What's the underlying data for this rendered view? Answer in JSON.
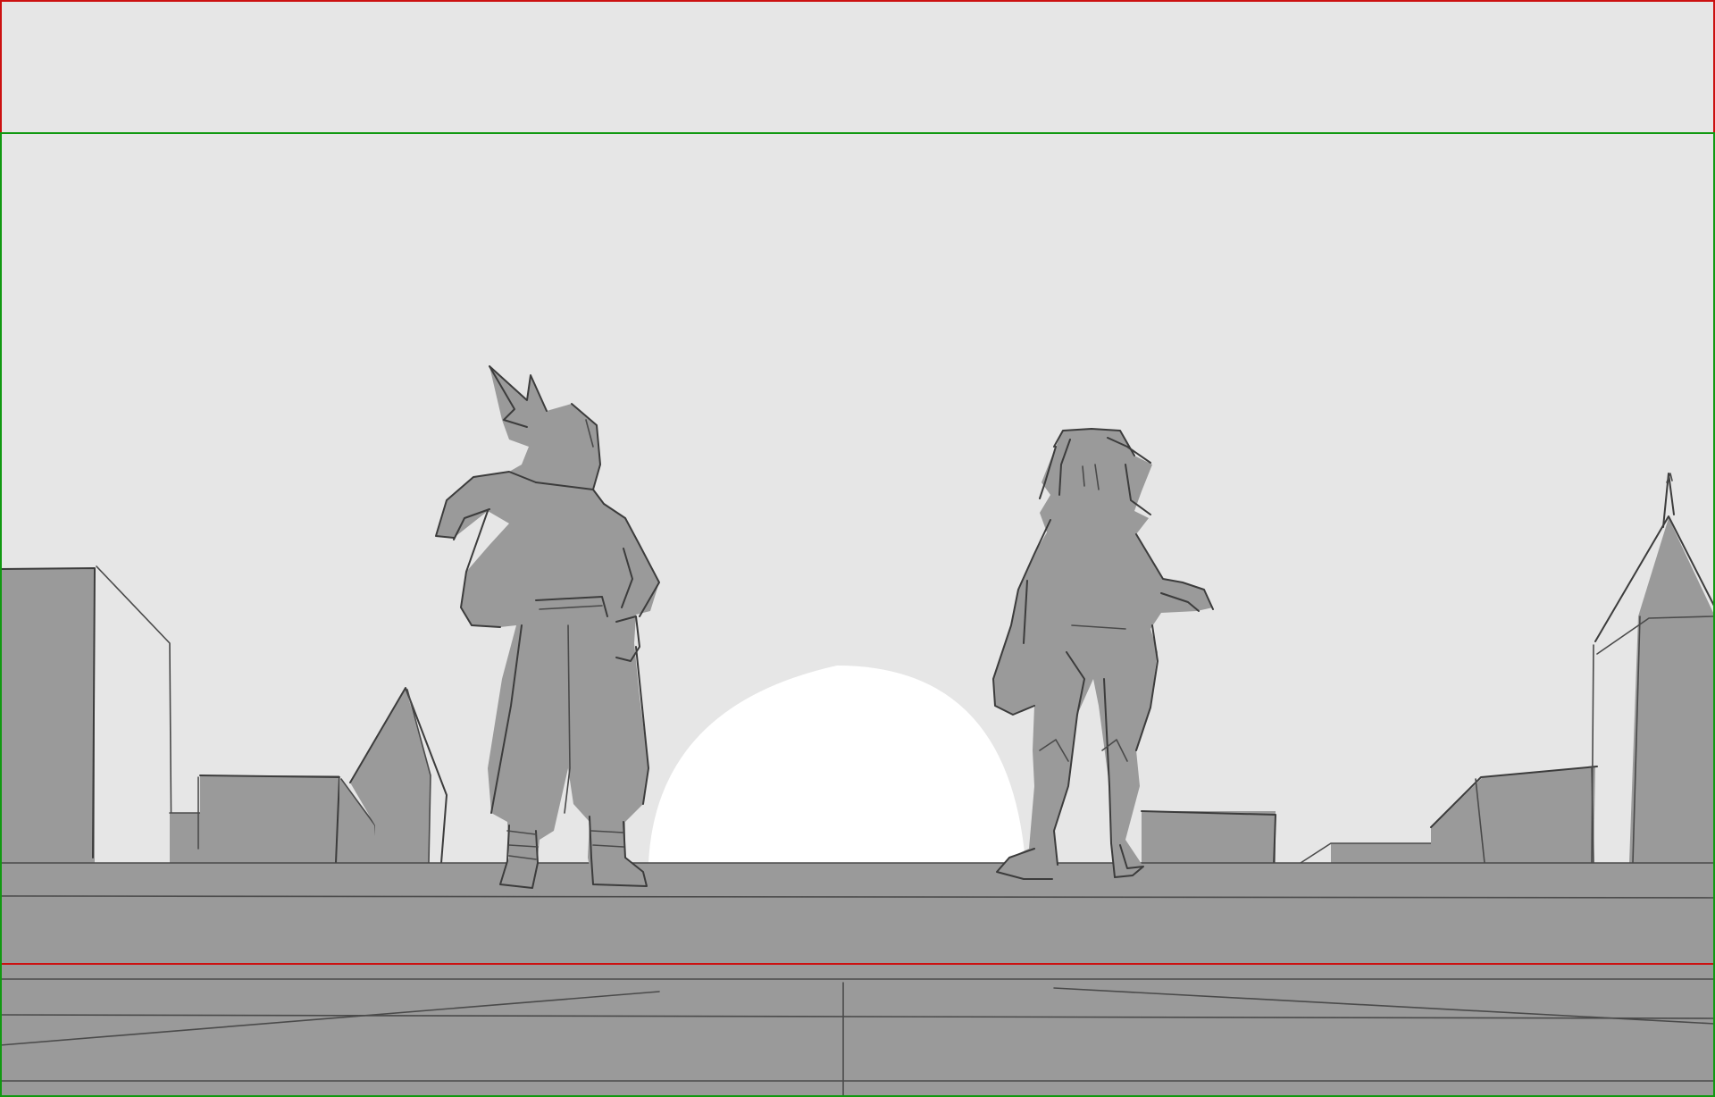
{
  "canvas": {
    "background_color": "#e6e6e6",
    "ground_color": "#9a9a9a",
    "sun_color": "#ffffff",
    "line_color": "#3c3c3c"
  },
  "guides": {
    "safe_frame_color": "#cc1111",
    "title_safe_color": "#119911"
  },
  "scene": {
    "description_icons": [
      "sun-icon",
      "character-scarf-silhouette",
      "character-long-hair-silhouette"
    ]
  }
}
